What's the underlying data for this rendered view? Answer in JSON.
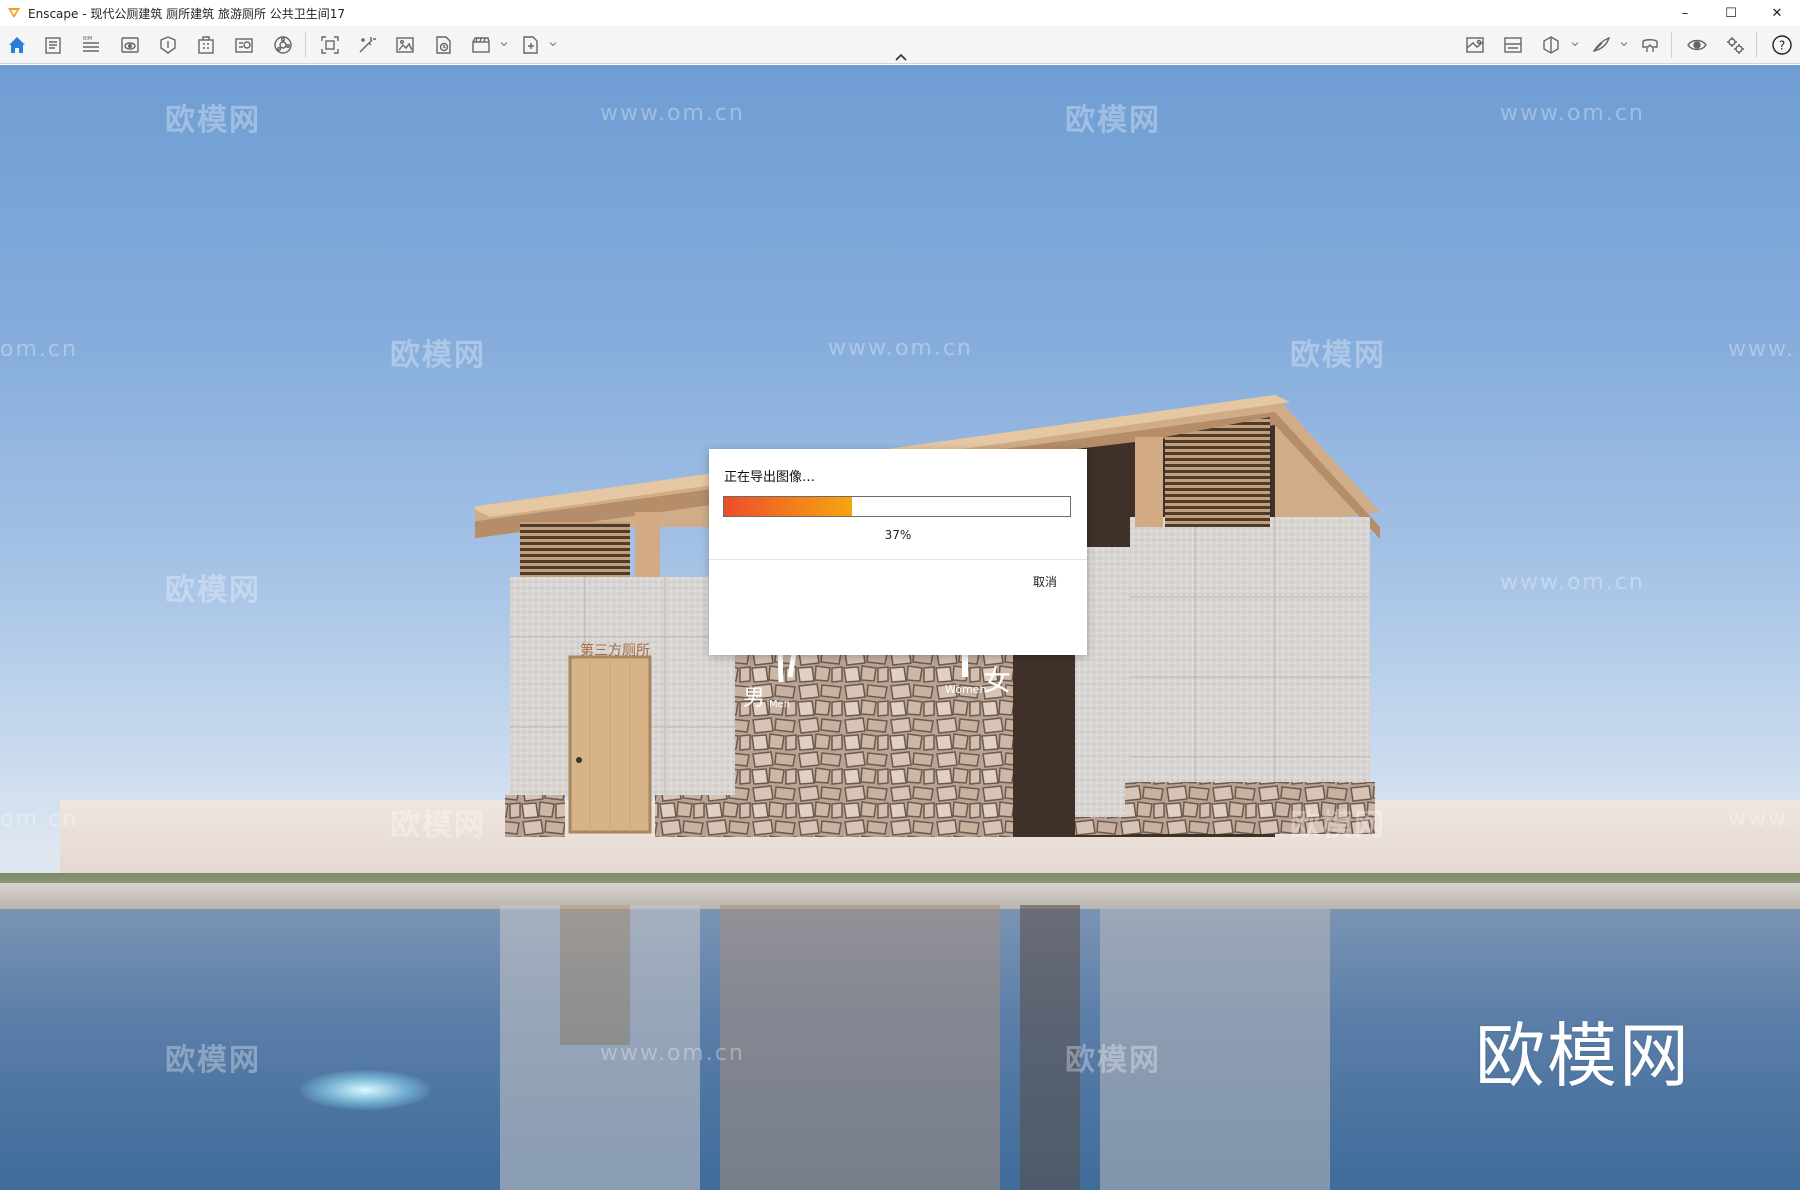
{
  "window": {
    "title": "Enscape - 现代公厕建筑 厕所建筑 旅游厕所 公共卫生间17",
    "controls": {
      "minimize": "–",
      "maximize": "☐",
      "close": "✕"
    }
  },
  "toolbar": {
    "left_icons": [
      "home-icon",
      "documents-icon",
      "bim-icon",
      "views-icon",
      "objects-icon",
      "site-context-icon",
      "asset-library-icon",
      "material-editor-icon",
      "capture-icon",
      "batch-render-icon",
      "screenshot-icon",
      "panorama-icon",
      "video-icon",
      "export-icon"
    ],
    "right_icons": [
      "minimap-icon",
      "atmosphere-icon",
      "section-icon",
      "sketch-icon",
      "vr-headset-icon",
      "visibility-icon",
      "settings-icon",
      "help-icon"
    ],
    "help_label": "?"
  },
  "viewport": {
    "watermark_logo": "欧模网",
    "watermark_url": "www.om.cn",
    "watermark_url_partial": "om.cn",
    "watermark_url_cut": "www.",
    "brand_mark": "欧模网",
    "sign_third_party": "第三方厕所",
    "sign_men_cn": "男",
    "sign_men_en": "Men",
    "sign_women_cn": "女",
    "sign_women_en": "Women"
  },
  "export_dialog": {
    "title": "正在导出图像…",
    "progress_percent": 37,
    "progress_label": "37%",
    "cancel_label": "取消"
  },
  "colors": {
    "accent_home": "#2f7bd8",
    "progress_start": "#ec4d2a",
    "progress_end": "#f6a511",
    "logo": "#f29a1b"
  }
}
